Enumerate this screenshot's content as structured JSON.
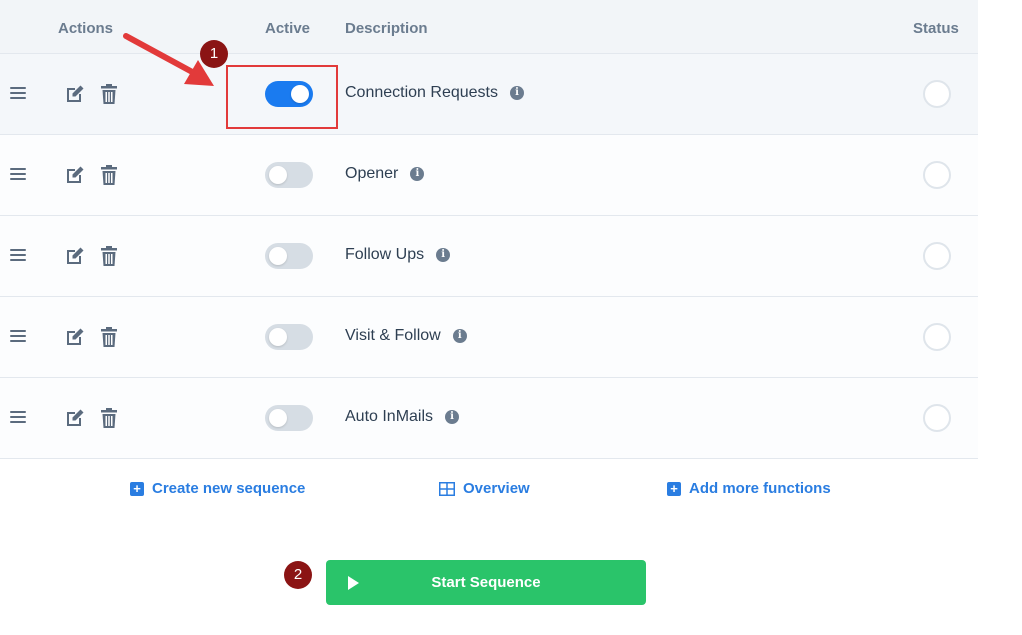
{
  "table": {
    "headers": {
      "actions": "Actions",
      "active": "Active",
      "description": "Description",
      "status": "Status"
    },
    "rows": [
      {
        "description": "Connection Requests",
        "active": true,
        "highlighted": true
      },
      {
        "description": "Opener",
        "active": false,
        "highlighted": false
      },
      {
        "description": "Follow Ups",
        "active": false,
        "highlighted": false
      },
      {
        "description": "Visit & Follow",
        "active": false,
        "highlighted": false
      },
      {
        "description": "Auto InMails",
        "active": false,
        "highlighted": false
      }
    ],
    "info_glyph": "i",
    "row_icons": [
      "menu-icon",
      "edit-icon",
      "trash-icon",
      "info-icon"
    ]
  },
  "links": {
    "create": "Create new sequence",
    "overview": "Overview",
    "add": "Add more functions",
    "plus_glyph": "+"
  },
  "start_button": {
    "label": "Start Sequence"
  },
  "annotations": {
    "badge_1": "1",
    "badge_2": "2",
    "arrow_color": "#e23a3a",
    "badge_color": "#8b1414"
  },
  "colors": {
    "accent": "#2a7de1",
    "toggle_on": "#1a7bf0",
    "toggle_off": "#d6dde4",
    "start_green": "#2ac46a"
  }
}
